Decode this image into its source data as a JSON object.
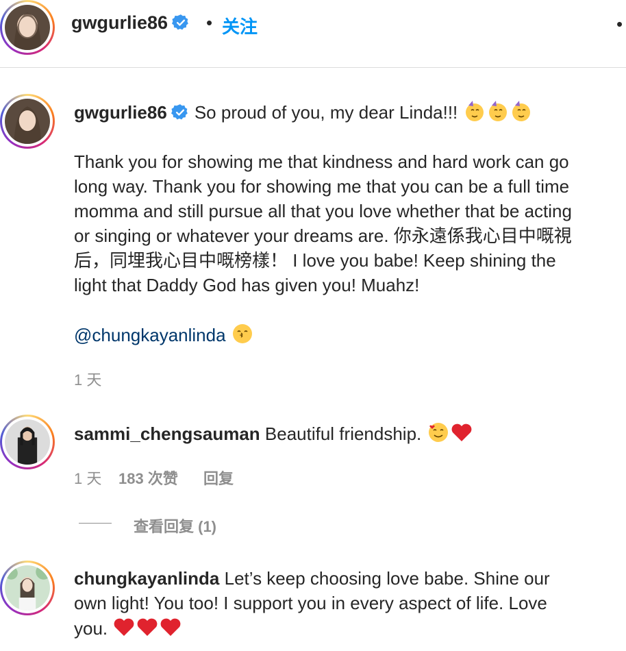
{
  "header": {
    "username": "gwgurlie86",
    "separator": "•",
    "follow_label": "关注",
    "more_icon": "more-dots-icon"
  },
  "post": {
    "username": "gwgurlie86",
    "first_line": "So proud of you, my dear Linda!!!",
    "body_lines": [
      "Thank you for showing me that kindness and hard work can go",
      "long way. Thank you for showing me that you can be a full time",
      "momma and still pursue all that you love whether that be acting",
      "or singing or whatever your dreams are. 你永遠係我心目中嘅視",
      "后，同埋我心目中嘅榜樣！  I love you babe! Keep shining the",
      "light that Daddy God has given you! Muahz!"
    ],
    "mention": "@chungkayanlinda",
    "time": "1 天"
  },
  "comments": [
    {
      "username": "sammi_chengsauman",
      "text": "Beautiful friendship.",
      "time": "1 天",
      "likes": "183 次赞",
      "reply": "回复"
    },
    {
      "username": "chungkayanlinda",
      "lines": [
        "Let’s keep choosing love babe. Shine our",
        "own light! You too! I support you in every aspect of life. Love",
        "you."
      ]
    }
  ],
  "view_replies": "查看回复 (1)",
  "colors": {
    "accent": "#0095f6",
    "mention": "#00376b",
    "muted": "#8e8e8e",
    "text": "#262626",
    "verified": "#3897f0",
    "heart": "#e0232e"
  }
}
